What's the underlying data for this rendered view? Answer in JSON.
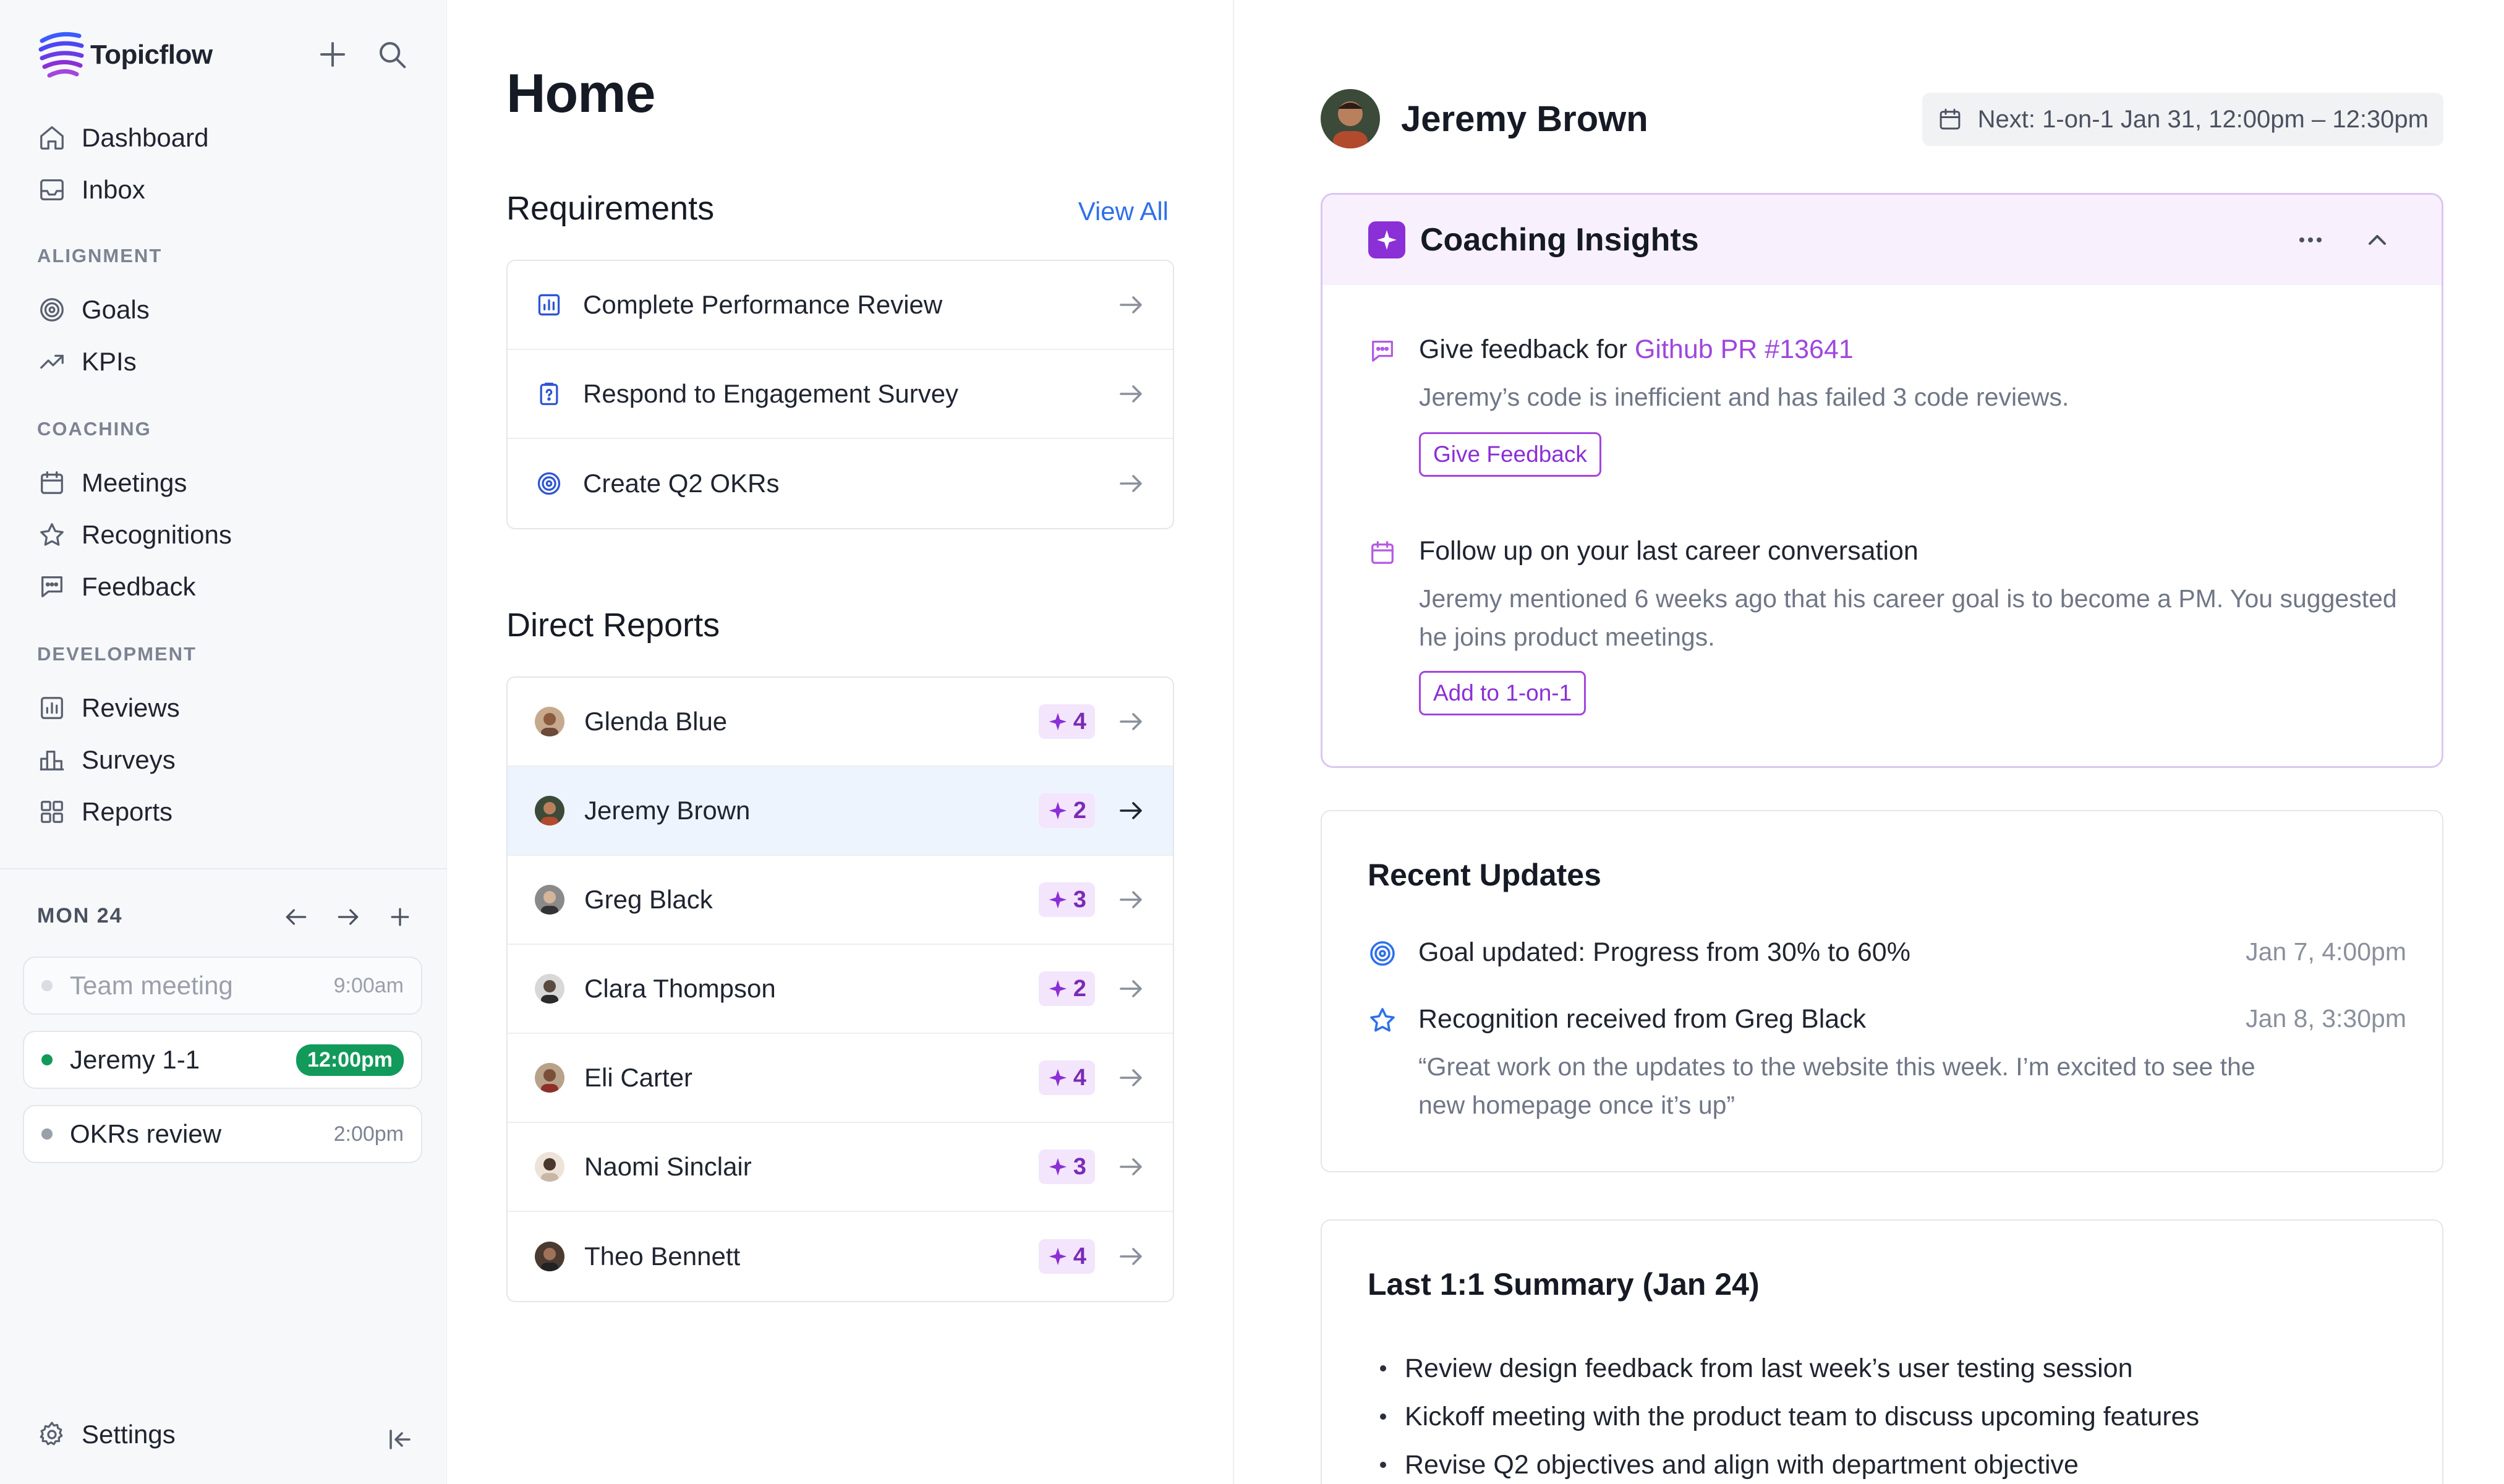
{
  "app": {
    "name": "Topicflow"
  },
  "sidebar": {
    "top_nav": [
      {
        "label": "Dashboard",
        "icon": "home-icon"
      },
      {
        "label": "Inbox",
        "icon": "inbox-icon"
      }
    ],
    "sections": [
      {
        "label": "ALIGNMENT",
        "items": [
          {
            "label": "Goals",
            "icon": "target-icon"
          },
          {
            "label": "KPIs",
            "icon": "trend-up-icon"
          }
        ]
      },
      {
        "label": "COACHING",
        "items": [
          {
            "label": "Meetings",
            "icon": "calendar-icon"
          },
          {
            "label": "Recognitions",
            "icon": "star-icon"
          },
          {
            "label": "Feedback",
            "icon": "chat-icon"
          }
        ]
      },
      {
        "label": "DEVELOPMENT",
        "items": [
          {
            "label": "Reviews",
            "icon": "bar-chart-icon"
          },
          {
            "label": "Surveys",
            "icon": "survey-icon"
          },
          {
            "label": "Reports",
            "icon": "grid-icon"
          }
        ]
      }
    ],
    "calendar": {
      "date_label": "MON 24",
      "events": [
        {
          "title": "Team meeting",
          "time": "9:00am",
          "state": "past"
        },
        {
          "title": "Jeremy 1-1",
          "time": "12:00pm",
          "state": "current"
        },
        {
          "title": "OKRs review",
          "time": "2:00pm",
          "state": "upcoming"
        }
      ]
    },
    "settings_label": "Settings"
  },
  "home": {
    "title": "Home",
    "requirements": {
      "heading": "Requirements",
      "view_all": "View All",
      "items": [
        {
          "label": "Complete Performance Review",
          "icon": "bar-chart-icon"
        },
        {
          "label": "Respond to Engagement Survey",
          "icon": "clipboard-question-icon"
        },
        {
          "label": "Create Q2 OKRs",
          "icon": "target-icon"
        }
      ]
    },
    "direct_reports": {
      "heading": "Direct Reports",
      "people": [
        {
          "name": "Glenda Blue",
          "insights": "4",
          "selected": false
        },
        {
          "name": "Jeremy Brown",
          "insights": "2",
          "selected": true
        },
        {
          "name": "Greg Black",
          "insights": "3",
          "selected": false
        },
        {
          "name": "Clara Thompson",
          "insights": "2",
          "selected": false
        },
        {
          "name": "Eli Carter",
          "insights": "4",
          "selected": false
        },
        {
          "name": "Naomi Sinclair",
          "insights": "3",
          "selected": false
        },
        {
          "name": "Theo Bennett",
          "insights": "4",
          "selected": false
        }
      ]
    }
  },
  "detail": {
    "person_name": "Jeremy Brown",
    "next_meeting": "Next: 1-on-1 Jan 31, 12:00pm – 12:30pm",
    "coaching": {
      "title": "Coaching Insights",
      "insights": [
        {
          "title_prefix": "Give feedback for ",
          "title_link": "Github PR #13641",
          "description": "Jeremy’s code is inefficient and has failed 3 code reviews.",
          "action": "Give Feedback",
          "icon": "chat-icon"
        },
        {
          "title_prefix": "Follow up on your last career conversation",
          "description": "Jeremy mentioned 6 weeks ago that his career goal is to become a PM. You suggested he joins product meetings.",
          "action": "Add to 1-on-1",
          "icon": "calendar-icon"
        }
      ]
    },
    "recent_updates": {
      "title": "Recent Updates",
      "items": [
        {
          "text": "Goal updated: Progress from 30% to 60%",
          "date": "Jan 7, 4:00pm",
          "icon": "target-icon"
        },
        {
          "text": "Recognition received from Greg Black",
          "date": "Jan 8, 3:30pm",
          "icon": "star-icon",
          "quote": "“Great work on the updates to the website this week. I’m excited to see the new homepage once it’s up”"
        }
      ]
    },
    "last_summary": {
      "title": "Last 1:1 Summary (Jan 24)",
      "bullets": [
        "Review design feedback from last week’s user testing session",
        "Kickoff meeting with the product team to discuss upcoming features",
        "Revise Q2 objectives and align with department objective"
      ]
    }
  },
  "colors": {
    "accent_blue": "#2f6fea",
    "accent_purple": "#8b2fd6",
    "badge_bg": "#f3e5fb",
    "current_event_green": "#129a5b",
    "selected_row_bg": "#eef4fd"
  }
}
